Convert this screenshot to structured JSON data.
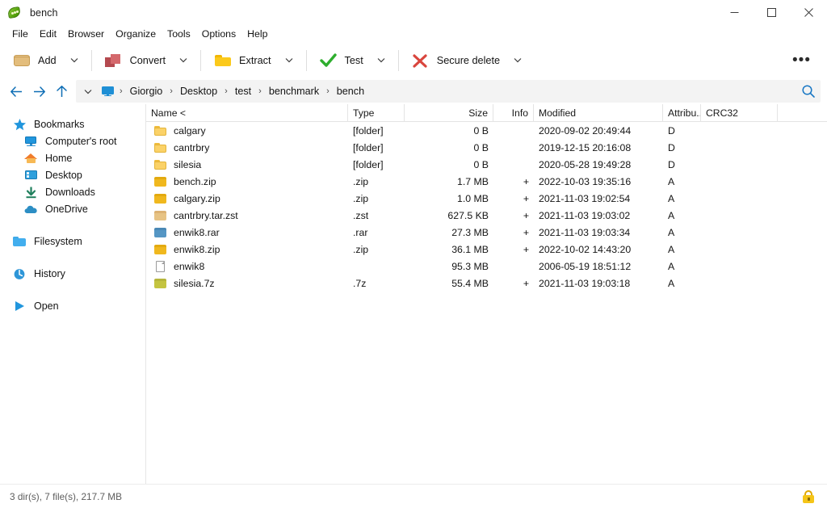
{
  "window": {
    "title": "bench",
    "app_icon": "peazip-pod-icon",
    "controls": {
      "minimize": "minimize-icon",
      "maximize": "maximize-icon",
      "close": "close-icon"
    }
  },
  "menubar": {
    "items": [
      "File",
      "Edit",
      "Browser",
      "Organize",
      "Tools",
      "Options",
      "Help"
    ]
  },
  "toolbar": {
    "buttons": [
      {
        "label": "Add",
        "icon": "add-archive-icon",
        "has_caret": true
      },
      {
        "label": "Convert",
        "icon": "convert-icon",
        "has_caret": true
      },
      {
        "label": "Extract",
        "icon": "extract-folder-icon",
        "has_caret": true
      },
      {
        "label": "Test",
        "icon": "test-check-icon",
        "has_caret": true
      },
      {
        "label": "Secure delete",
        "icon": "secure-delete-x-icon",
        "has_caret": true
      }
    ],
    "overflow_label": "•••"
  },
  "address": {
    "back_icon": "arrow-left-icon",
    "forward_icon": "arrow-right-icon",
    "up_icon": "arrow-up-icon",
    "dropdown_icon": "chevron-down-icon",
    "root_icon": "computer-monitor-icon",
    "breadcrumbs": [
      "Giorgio",
      "Desktop",
      "test",
      "benchmark",
      "bench"
    ],
    "separator": "›",
    "search_icon": "search-icon"
  },
  "sidebar": {
    "groups": [
      {
        "header": {
          "label": "Bookmarks",
          "icon": "star-icon"
        },
        "items": [
          {
            "label": "Computer's root",
            "icon": "computer-monitor-icon"
          },
          {
            "label": "Home",
            "icon": "home-icon"
          },
          {
            "label": "Desktop",
            "icon": "desktop-icon"
          },
          {
            "label": "Downloads",
            "icon": "download-icon"
          },
          {
            "label": "OneDrive",
            "icon": "cloud-icon"
          }
        ]
      },
      {
        "header": {
          "label": "Filesystem",
          "icon": "folder-icon"
        },
        "items": []
      },
      {
        "header": {
          "label": "History",
          "icon": "history-clock-icon"
        },
        "items": []
      },
      {
        "header": {
          "label": "Open",
          "icon": "play-triangle-icon"
        },
        "items": []
      }
    ]
  },
  "filelist": {
    "columns": [
      {
        "key": "name",
        "label": "Name <",
        "align": "left"
      },
      {
        "key": "type",
        "label": "Type",
        "align": "left"
      },
      {
        "key": "size",
        "label": "Size",
        "align": "right"
      },
      {
        "key": "info",
        "label": "Info",
        "align": "right"
      },
      {
        "key": "modified",
        "label": "Modified",
        "align": "left"
      },
      {
        "key": "attributes",
        "label": "Attribu...",
        "align": "left"
      },
      {
        "key": "crc32",
        "label": "CRC32",
        "align": "left"
      }
    ],
    "rows": [
      {
        "name": "calgary",
        "icon": "folder-icon",
        "icon_color": "#fbd268",
        "type": "[folder]",
        "size": "0 B",
        "info": "",
        "modified": "2020-09-02 20:49:44",
        "attributes": "D",
        "crc32": ""
      },
      {
        "name": "cantrbry",
        "icon": "folder-icon",
        "icon_color": "#fbd268",
        "type": "[folder]",
        "size": "0 B",
        "info": "",
        "modified": "2019-12-15 20:16:08",
        "attributes": "D",
        "crc32": ""
      },
      {
        "name": "silesia",
        "icon": "folder-icon",
        "icon_color": "#fbd268",
        "type": "[folder]",
        "size": "0 B",
        "info": "",
        "modified": "2020-05-28 19:49:28",
        "attributes": "D",
        "crc32": ""
      },
      {
        "name": "bench.zip",
        "icon": "archive-zip-icon",
        "icon_color": "#f0b81e",
        "type": ".zip",
        "size": "1.7 MB",
        "info": "+",
        "modified": "2022-10-03 19:35:16",
        "attributes": "A",
        "crc32": ""
      },
      {
        "name": "calgary.zip",
        "icon": "archive-zip-icon",
        "icon_color": "#f0b81e",
        "type": ".zip",
        "size": "1.0 MB",
        "info": "+",
        "modified": "2021-11-03 19:02:54",
        "attributes": "A",
        "crc32": ""
      },
      {
        "name": "cantrbry.tar.zst",
        "icon": "archive-zst-icon",
        "icon_color": "#e7c384",
        "type": ".zst",
        "size": "627.5 KB",
        "info": "+",
        "modified": "2021-11-03 19:03:02",
        "attributes": "A",
        "crc32": ""
      },
      {
        "name": "enwik8.rar",
        "icon": "archive-rar-icon",
        "icon_color": "#5596c4",
        "type": ".rar",
        "size": "27.3 MB",
        "info": "+",
        "modified": "2021-11-03 19:03:34",
        "attributes": "A",
        "crc32": ""
      },
      {
        "name": "enwik8.zip",
        "icon": "archive-zip-icon",
        "icon_color": "#f0b81e",
        "type": ".zip",
        "size": "36.1 MB",
        "info": "+",
        "modified": "2022-10-02 14:43:20",
        "attributes": "A",
        "crc32": ""
      },
      {
        "name": "enwik8",
        "icon": "file-page-icon",
        "icon_color": "#ffffff",
        "type": "",
        "size": "95.3 MB",
        "info": "",
        "modified": "2006-05-19 18:51:12",
        "attributes": "A",
        "crc32": ""
      },
      {
        "name": "silesia.7z",
        "icon": "archive-7z-icon",
        "icon_color": "#c4c440",
        "type": ".7z",
        "size": "55.4 MB",
        "info": "+",
        "modified": "2021-11-03 19:03:18",
        "attributes": "A",
        "crc32": ""
      }
    ]
  },
  "statusbar": {
    "text": "3 dir(s), 7 file(s), 217.7 MB",
    "lock_icon": "lock-icon"
  },
  "colors": {
    "accent_blue": "#1877c4",
    "folder_yellow": "#fbd268",
    "test_green": "#2eae2e",
    "delete_red": "#d9453d"
  }
}
